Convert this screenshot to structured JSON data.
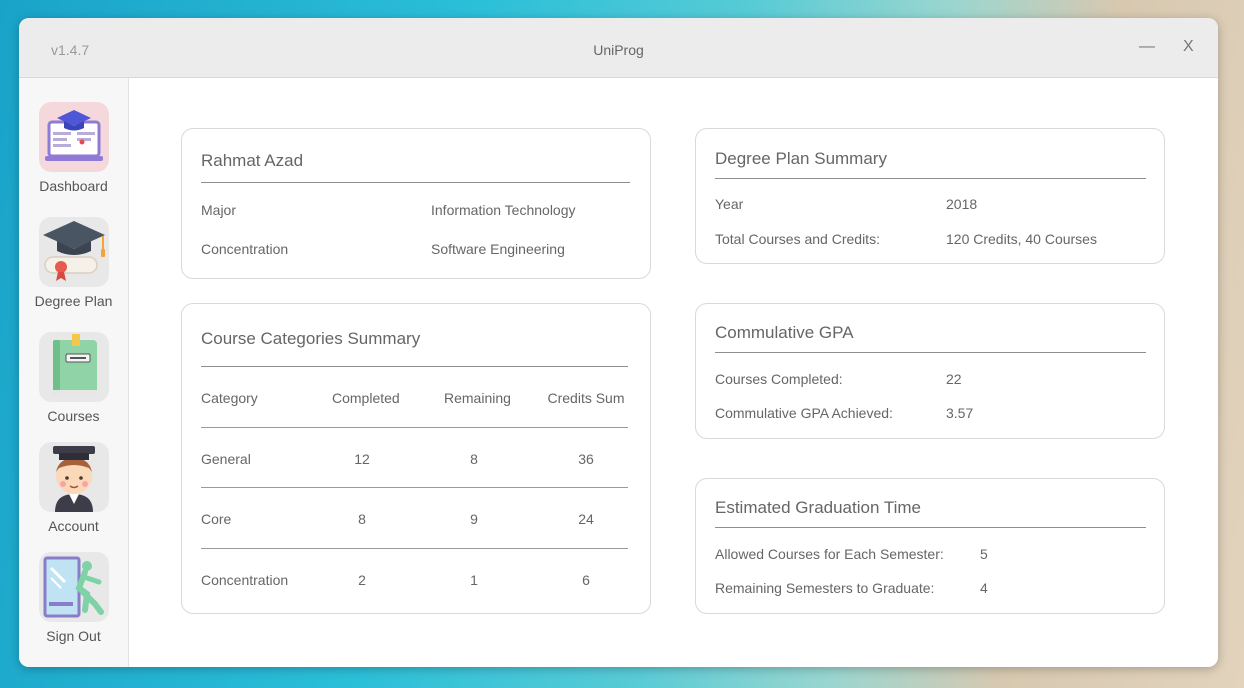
{
  "window": {
    "version": "v1.4.7",
    "title": "UniProg",
    "minimize": "—",
    "close": "X"
  },
  "sidebar": {
    "items": [
      {
        "label": "Dashboard",
        "icon": "dashboard-icon"
      },
      {
        "label": "Degree Plan",
        "icon": "graduation-cap-icon"
      },
      {
        "label": "Courses",
        "icon": "book-icon"
      },
      {
        "label": "Account",
        "icon": "student-avatar-icon"
      },
      {
        "label": "Sign Out",
        "icon": "exit-door-icon"
      }
    ]
  },
  "profile": {
    "name": "Rahmat Azad",
    "rows": [
      {
        "label": "Major",
        "value": "Information Technology"
      },
      {
        "label": "Concentration",
        "value": "Software Engineering"
      }
    ]
  },
  "course_summary": {
    "title": "Course Categories Summary",
    "headers": [
      "Category",
      "Completed",
      "Remaining",
      "Credits Sum"
    ],
    "rows": [
      [
        "General",
        "12",
        "8",
        "36"
      ],
      [
        "Core",
        "8",
        "9",
        "24"
      ],
      [
        "Concentration",
        "2",
        "1",
        "6"
      ]
    ]
  },
  "degree_plan": {
    "title": "Degree Plan Summary",
    "rows": [
      {
        "label": "Year",
        "value": "2018"
      },
      {
        "label": "Total Courses and Credits:",
        "value": "120 Credits, 40 Courses"
      }
    ]
  },
  "gpa": {
    "title": "Commulative GPA",
    "rows": [
      {
        "label": "Courses Completed:",
        "value": "22"
      },
      {
        "label": "Commulative GPA Achieved:",
        "value": "3.57"
      }
    ]
  },
  "graduation": {
    "title": "Estimated Graduation Time",
    "rows": [
      {
        "label": "Allowed Courses for Each Semester:",
        "value": "5"
      },
      {
        "label": "Remaining Semesters to Graduate:",
        "value": "4"
      }
    ]
  }
}
